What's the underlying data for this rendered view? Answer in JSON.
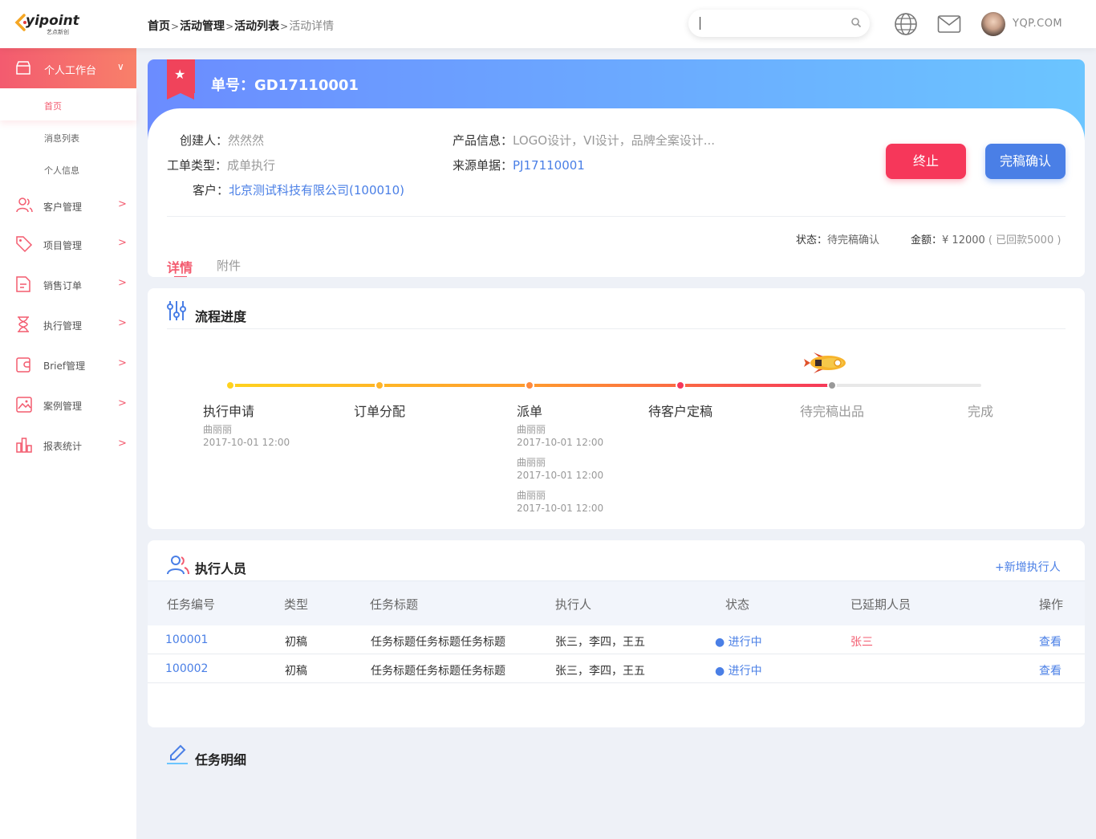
{
  "brand": {
    "name": "yipoint",
    "sub": "艺点新创"
  },
  "breadcrumb": [
    "首页",
    "活动管理",
    "活动列表",
    "活动详情"
  ],
  "breadcrumb_sep": ">",
  "search": {
    "placeholder": ""
  },
  "user": {
    "name": "YQP.COM"
  },
  "sidebar": {
    "active_group": "个人工作台",
    "sub_items": [
      "首页",
      "消息列表",
      "个人信息"
    ],
    "items": [
      "客户管理",
      "项目管理",
      "销售订单",
      "执行管理",
      "Brief管理",
      "案例管理",
      "报表统计"
    ],
    "arrow": ">",
    "chevron": "∨"
  },
  "order": {
    "title": "单号：GD17110001",
    "creator_label": "创建人：",
    "creator": "然然然",
    "type_label": "工单类型：",
    "type": "成单执行",
    "customer_label": "客户：",
    "customer": "北京测试科技有限公司(100010)",
    "product_label": "产品信息：",
    "product": "LOGO设计，VI设计，品牌全案设计...",
    "source_label": "来源单据：",
    "source": "PJ17110001",
    "stop_label": "终止",
    "confirm_label": "完稿确认",
    "status_label": "状态：",
    "status": "待完稿确认",
    "amount_label": "金额：",
    "amount": "¥ 12000",
    "paid": "( 已回款5000 )",
    "tabs": [
      "详情",
      "附件"
    ]
  },
  "process": {
    "title": "流程进度",
    "current_index": 4,
    "stages": [
      {
        "name": "执行申请",
        "logs": [
          {
            "user": "曲丽丽",
            "time": "2017-10-01 12:00"
          }
        ]
      },
      {
        "name": "订单分配",
        "logs": []
      },
      {
        "name": "派单",
        "logs": [
          {
            "user": "曲丽丽",
            "time": "2017-10-01 12:00"
          },
          {
            "user": "曲丽丽",
            "time": "2017-10-01 12:00"
          },
          {
            "user": "曲丽丽",
            "time": "2017-10-01 12:00"
          }
        ]
      },
      {
        "name": "待客户定稿",
        "logs": []
      },
      {
        "name": "待完稿出品",
        "logs": []
      },
      {
        "name": "完成",
        "logs": []
      }
    ],
    "colors": {
      "done_text": "#333333",
      "pending_text": "#999999",
      "dots": [
        "#ffd21e",
        "#ffb52a",
        "#ff8a3d",
        "#f6375a",
        "#999999",
        "#e0e0e0"
      ]
    }
  },
  "executors": {
    "title": "执行人员",
    "add_label": "+新增执行人",
    "columns": [
      "任务编号",
      "类型",
      "任务标题",
      "执行人",
      "状态",
      "已延期人员",
      "操作"
    ],
    "rows": [
      {
        "id": "100001",
        "type": "初稿",
        "title": "任务标题任务标题任务标题",
        "people": "张三，李四，王五",
        "status": "● 进行中",
        "delayed": "张三",
        "action": "查看"
      },
      {
        "id": "100002",
        "type": "初稿",
        "title": "任务标题任务标题任务标题",
        "people": "张三，李四，王五",
        "status": "● 进行中",
        "delayed": "",
        "action": "查看"
      }
    ]
  },
  "task_detail": {
    "title": "任务明细"
  },
  "colors": {
    "primary": "#4a7fe6",
    "accent": "#f35b6f",
    "danger": "#f6375a"
  },
  "icons": {
    "globe": "globe-icon",
    "mail": "mail-icon",
    "search": "search-icon",
    "star": "star-icon"
  }
}
